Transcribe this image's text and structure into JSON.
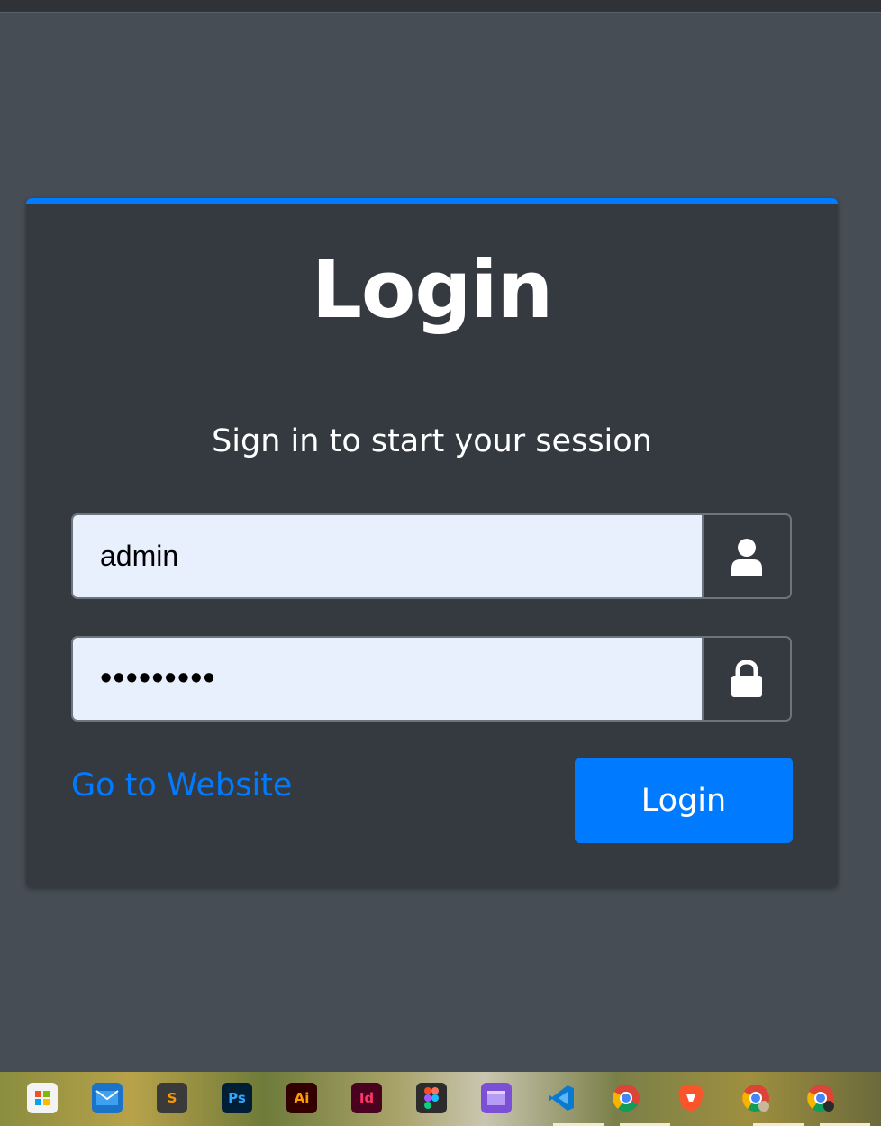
{
  "card": {
    "title": "Login",
    "subtitle": "Sign in to start your session"
  },
  "form": {
    "username_value": "admin",
    "password_value": "•••••••••",
    "go_to_website": "Go to Website",
    "login_button": "Login"
  },
  "icons": {
    "username_addon": "user-icon",
    "password_addon": "lock-icon"
  },
  "colors": {
    "accent": "#007bff",
    "card_bg": "#343a40",
    "page_bg": "#464d55",
    "input_bg": "#e8f0fe"
  },
  "taskbar": {
    "apps": [
      {
        "name": "microsoft-store-icon",
        "text": ""
      },
      {
        "name": "mail-icon",
        "text": ""
      },
      {
        "name": "sublime-text-icon",
        "text": "S"
      },
      {
        "name": "photoshop-icon",
        "text": "Ps"
      },
      {
        "name": "illustrator-icon",
        "text": "Ai"
      },
      {
        "name": "indesign-icon",
        "text": "Id"
      },
      {
        "name": "figma-icon",
        "text": ""
      },
      {
        "name": "clipchamp-icon",
        "text": ""
      },
      {
        "name": "vscode-icon",
        "text": ""
      },
      {
        "name": "chrome-icon",
        "text": ""
      },
      {
        "name": "brave-icon",
        "text": ""
      },
      {
        "name": "chrome-profile-icon",
        "text": ""
      },
      {
        "name": "chrome-profile-2-icon",
        "text": ""
      }
    ]
  }
}
